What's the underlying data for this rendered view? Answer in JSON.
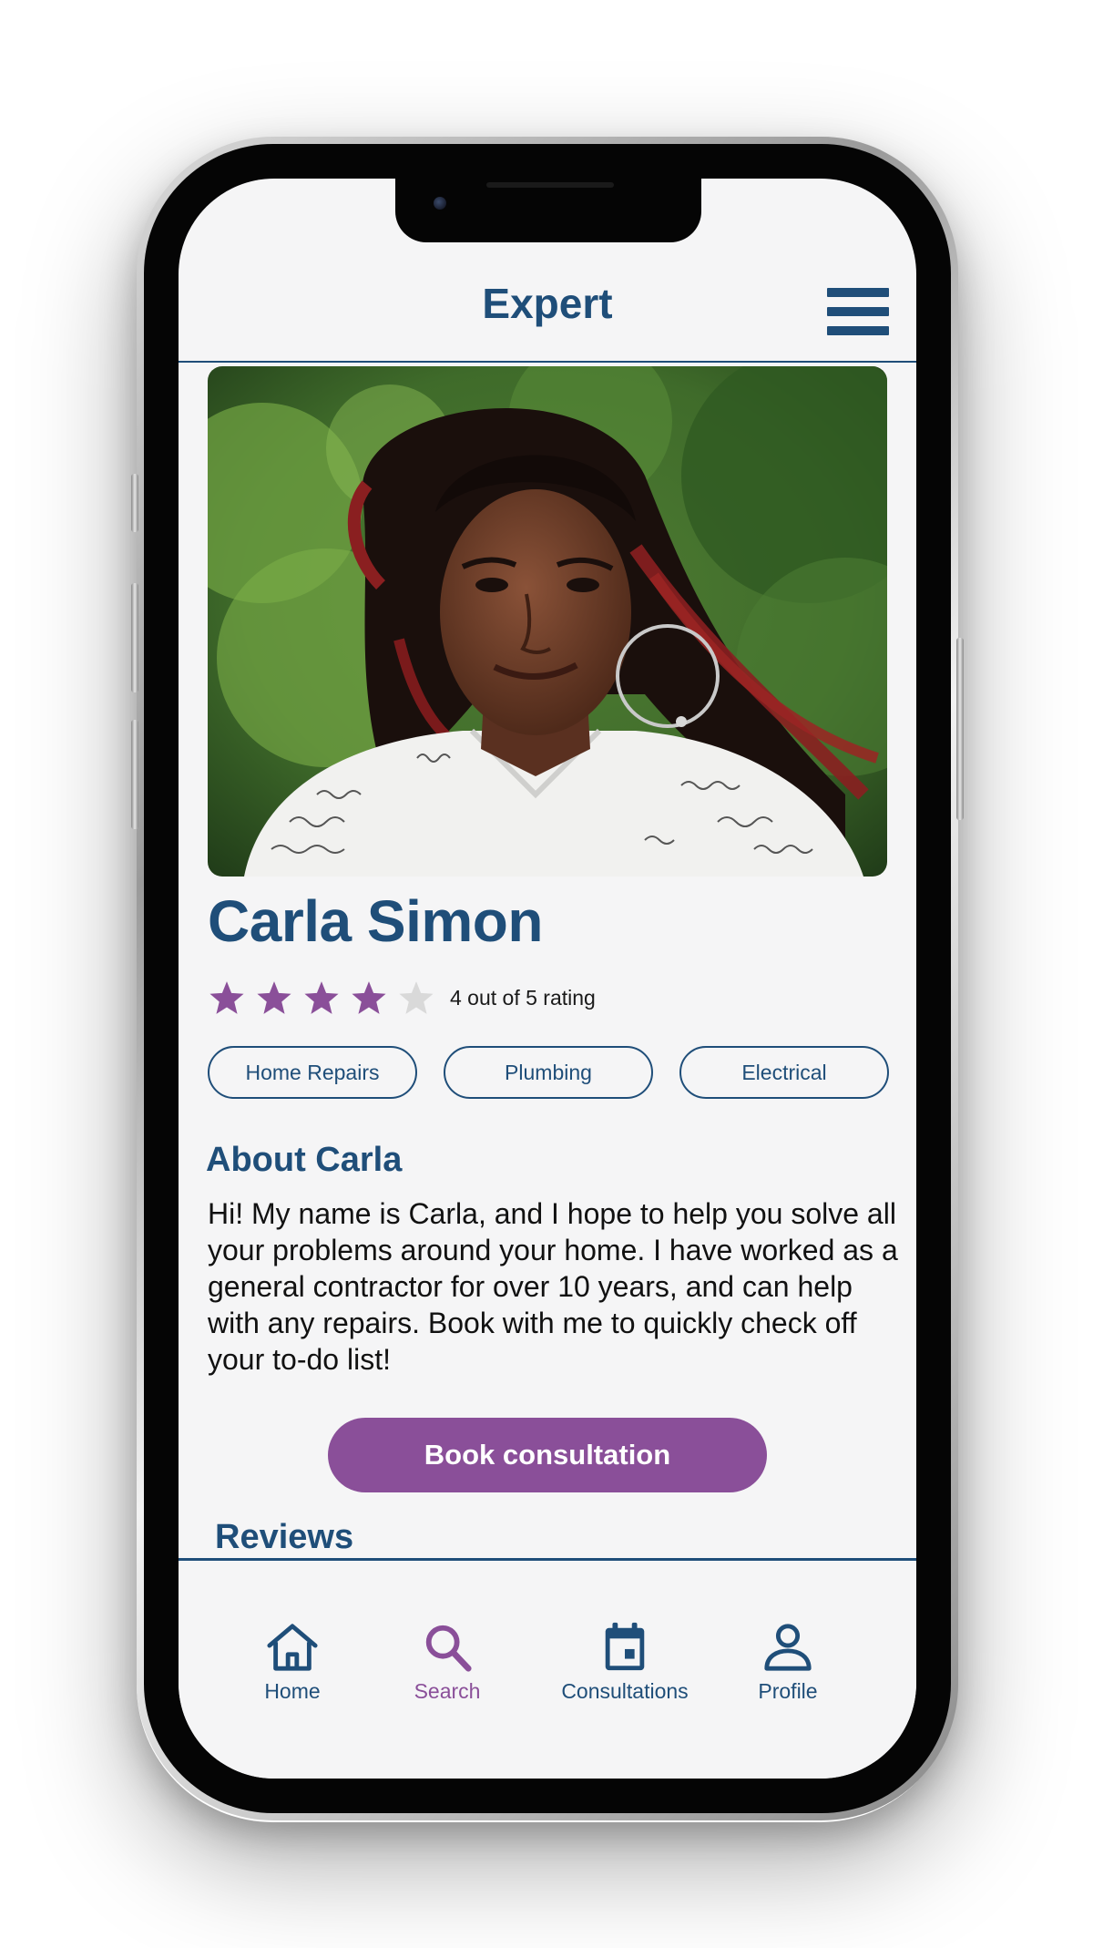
{
  "header": {
    "title": "Expert",
    "menu_icon": "hamburger-menu-icon"
  },
  "expert": {
    "photo_alt": "Carla Simon",
    "name": "Carla Simon",
    "rating": 4,
    "rating_max": 5,
    "rating_text": "4 out of 5 rating",
    "tags": [
      "Home Repairs",
      "Plumbing",
      "Electrical"
    ],
    "about_heading": "About Carla",
    "about_text": "Hi! My name is Carla, and I hope to help you solve all your problems around your home. I have worked as a general contractor for over 10 years, and can help with any repairs. Book with me to quickly check off your to-do list!",
    "book_label": "Book consultation",
    "reviews_heading": "Reviews"
  },
  "nav": {
    "items": [
      {
        "label": "Home",
        "icon": "home-icon",
        "active": false
      },
      {
        "label": "Search",
        "icon": "search-icon",
        "active": true
      },
      {
        "label": "Consultations",
        "icon": "calendar-icon",
        "active": false
      },
      {
        "label": "Profile",
        "icon": "person-icon",
        "active": false
      }
    ]
  },
  "colors": {
    "primary": "#1f4e79",
    "accent": "#8a4f99",
    "star_filled": "#8a4f99",
    "star_empty": "#d9d9d9",
    "background": "#f5f5f6"
  }
}
